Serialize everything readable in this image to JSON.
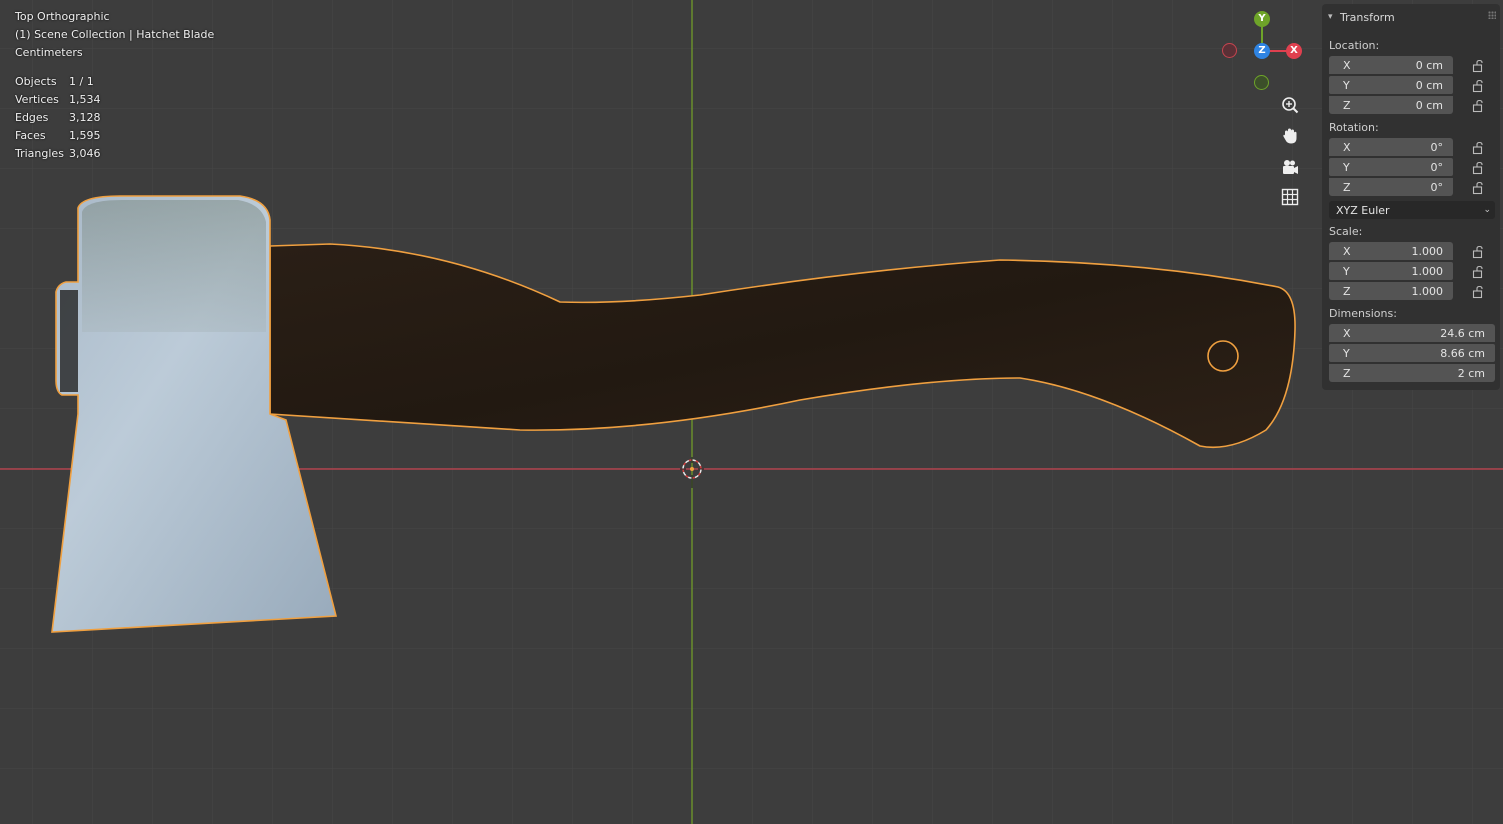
{
  "viewport": {
    "view_name": "Top Orthographic",
    "collection": "(1) Scene Collection | Hatchet Blade",
    "units": "Centimeters",
    "stats": [
      {
        "label": "Objects",
        "value": "1 / 1"
      },
      {
        "label": "Vertices",
        "value": "1,534"
      },
      {
        "label": "Edges",
        "value": "3,128"
      },
      {
        "label": "Faces",
        "value": "1,595"
      },
      {
        "label": "Triangles",
        "value": "3,046"
      }
    ]
  },
  "gizmo": {
    "y_label": "Y",
    "z_label": "Z",
    "x_label": "X",
    "colors": {
      "x": "#e0404f",
      "y": "#6ea429",
      "z": "#2f84e3"
    }
  },
  "nav_icons": [
    "zoom-icon",
    "hand-pan-icon",
    "camera-icon",
    "grid-icon"
  ],
  "transform_panel": {
    "title": "Transform",
    "location": {
      "label": "Location:",
      "x": {
        "axis": "X",
        "value": "0 cm"
      },
      "y": {
        "axis": "Y",
        "value": "0 cm"
      },
      "z": {
        "axis": "Z",
        "value": "0 cm"
      }
    },
    "rotation": {
      "label": "Rotation:",
      "x": {
        "axis": "X",
        "value": "0°"
      },
      "y": {
        "axis": "Y",
        "value": "0°"
      },
      "z": {
        "axis": "Z",
        "value": "0°"
      }
    },
    "rotation_mode": "XYZ Euler",
    "scale": {
      "label": "Scale:",
      "x": {
        "axis": "X",
        "value": "1.000"
      },
      "y": {
        "axis": "Y",
        "value": "1.000"
      },
      "z": {
        "axis": "Z",
        "value": "1.000"
      }
    },
    "dimensions": {
      "label": "Dimensions:",
      "x": {
        "axis": "X",
        "value": "24.6 cm"
      },
      "y": {
        "axis": "Y",
        "value": "8.66 cm"
      },
      "z": {
        "axis": "Z",
        "value": "2 cm"
      }
    }
  },
  "colors": {
    "background": "#3d3d3d",
    "x_axis_line": "#b0424d",
    "y_axis_line": "#6a8f2c",
    "selection_outline": "#f0a040"
  }
}
